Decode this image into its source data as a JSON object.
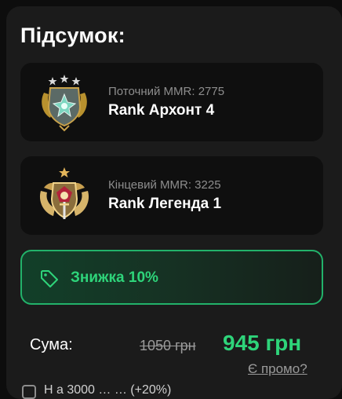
{
  "summary": {
    "title": "Підсумок:"
  },
  "current_rank": {
    "caption": "Поточний MMR: 2775",
    "name": "Rank Архонт 4",
    "icon": "archon-medal-icon"
  },
  "target_rank": {
    "caption": "Кінцевий MMR: 3225",
    "name": "Rank Легенда 1",
    "icon": "legend-medal-icon"
  },
  "discount": {
    "label": "Знижка 10%",
    "icon": "tag-icon"
  },
  "pricing": {
    "sum_label": "Сума:",
    "old_price": "1050 грн",
    "new_price": "945 грн",
    "promo_link": "Є промо?"
  },
  "option": {
    "text": "Н    а 3000 … … (+20%)"
  },
  "colors": {
    "accent_green": "#2ed47a",
    "panel_bg": "#1b1b1b",
    "card_bg": "#0f0f0f"
  }
}
